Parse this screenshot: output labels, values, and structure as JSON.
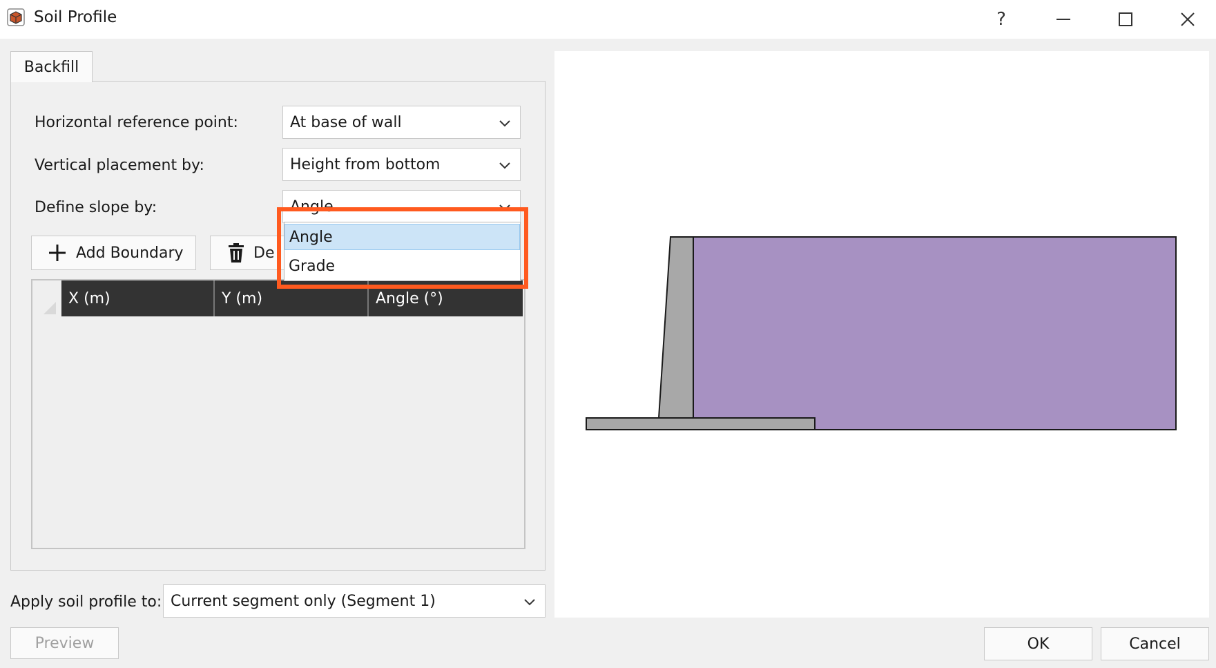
{
  "window": {
    "title": "Soil Profile",
    "help": "?",
    "minimize": "—",
    "maximize": "☐",
    "close": "✕"
  },
  "tab": {
    "label": "Backfill"
  },
  "form": {
    "horizontal_label": "Horizontal reference point:",
    "horizontal_value": "At base of wall",
    "vertical_label": "Vertical placement by:",
    "vertical_value": "Height from bottom",
    "slope_label": "Define slope by:",
    "slope_value": "Angle"
  },
  "toolbar": {
    "add_label": "Add Boundary",
    "delete_label": "De"
  },
  "table": {
    "columns": [
      "X (m)",
      "Y (m)",
      "Angle (°)"
    ],
    "rows": []
  },
  "dropdown": {
    "options": [
      "Angle",
      "Grade"
    ],
    "selected": "Angle"
  },
  "apply": {
    "label": "Apply soil profile to:",
    "value": "Current segment only (Segment 1)"
  },
  "buttons": {
    "preview": "Preview",
    "ok": "OK",
    "cancel": "Cancel"
  },
  "colors": {
    "soil": "#a791c2",
    "wall": "#a8a8a8",
    "highlight": "#ff5a1f",
    "selected_option": "#cce4f7"
  }
}
